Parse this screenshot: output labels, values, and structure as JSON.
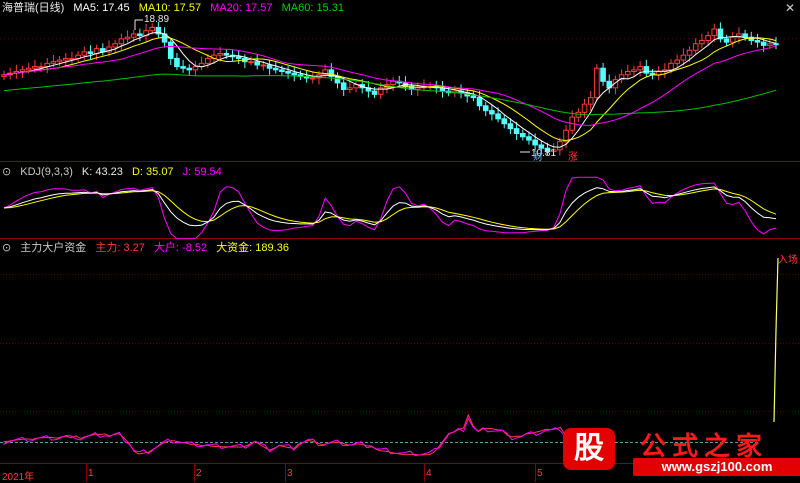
{
  "header_main": {
    "title": "海普瑞(日线)",
    "ma5": "MA5: 17.45",
    "ma10": "MA10: 17.57",
    "ma20": "MA20: 17.57",
    "ma60": "MA60: 15.31"
  },
  "header_kdj": {
    "title": "KDJ(9,3,3)",
    "k": "K: 43.23",
    "d": "D: 35.07",
    "j": "J: 59.54"
  },
  "header_fund": {
    "title": "主力大户资金",
    "zhuli": "主力: 3.27",
    "dahu": "大户: -8.52",
    "dazijin": "大资金: 189.36"
  },
  "annotations": {
    "high": "18.89",
    "low": "10.81",
    "tag_cai": "财",
    "tag_zhang": "涨",
    "right_tag": "入场"
  },
  "x_axis": [
    "2021年",
    "1",
    "2",
    "3",
    "4",
    "5"
  ],
  "logo": {
    "badge": "股",
    "title": "公式之家",
    "url": "www.gszj100.com"
  },
  "colors": {
    "up": "#ff3b3b",
    "down": "#54ffff",
    "ma5": "#ffffff",
    "ma10": "#ffff00",
    "ma20": "#ff00ff",
    "ma60": "#00c000",
    "divider": "#8b0000"
  },
  "chart_data": [
    {
      "type": "candlestick",
      "title": "海普瑞(日线)",
      "close": [
        15.6,
        15.7,
        15.8,
        15.9,
        16.0,
        16.1,
        16.1,
        16.3,
        16.4,
        16.5,
        16.6,
        16.6,
        16.8,
        17.0,
        16.9,
        17.2,
        17.0,
        17.3,
        17.5,
        17.8,
        17.9,
        18.1,
        18.0,
        18.3,
        18.5,
        18.1,
        17.6,
        16.6,
        16.1,
        16.0,
        15.9,
        16.1,
        16.3,
        16.6,
        16.8,
        16.9,
        16.8,
        16.7,
        16.6,
        16.4,
        16.4,
        16.2,
        16.2,
        16.0,
        15.9,
        15.8,
        15.7,
        15.6,
        15.5,
        15.4,
        15.4,
        15.6,
        15.9,
        15.5,
        15.1,
        14.7,
        14.8,
        15.0,
        14.8,
        14.6,
        14.4,
        14.8,
        15.0,
        15.2,
        15.1,
        14.9,
        14.7,
        14.8,
        14.9,
        14.9,
        14.8,
        14.6,
        14.5,
        14.6,
        14.5,
        14.3,
        14.2,
        13.7,
        13.4,
        13.2,
        12.9,
        12.6,
        12.3,
        12.0,
        11.8,
        11.6,
        11.3,
        11.1,
        10.9,
        11.0,
        11.5,
        12.2,
        13.0,
        13.3,
        13.8,
        14.2,
        16.0,
        15.2,
        14.8,
        15.3,
        15.6,
        15.8,
        15.9,
        16.1,
        15.7,
        15.6,
        15.8,
        15.9,
        16.3,
        16.5,
        16.8,
        17.1,
        17.5,
        17.7,
        18.0,
        18.4,
        17.8,
        17.6,
        17.9,
        18.1,
        17.9,
        17.7,
        17.6,
        17.4,
        17.5,
        17.45
      ],
      "high": "18.89",
      "low": "10.81",
      "ma_labels": [
        "MA5: 17.45",
        "MA10: 17.57",
        "MA20: 17.57",
        "MA60: 15.31"
      ]
    },
    {
      "type": "line",
      "title": "KDJ(9,3,3)",
      "series": [
        {
          "name": "K",
          "last": 43.23
        },
        {
          "name": "D",
          "last": 35.07
        },
        {
          "name": "J",
          "last": 59.54
        }
      ]
    },
    {
      "type": "line",
      "title": "主力大户资金",
      "series": [
        {
          "name": "主力",
          "last": 3.27
        },
        {
          "name": "大户",
          "last": -8.52
        },
        {
          "name": "大资金",
          "last": 189.36
        }
      ]
    }
  ]
}
